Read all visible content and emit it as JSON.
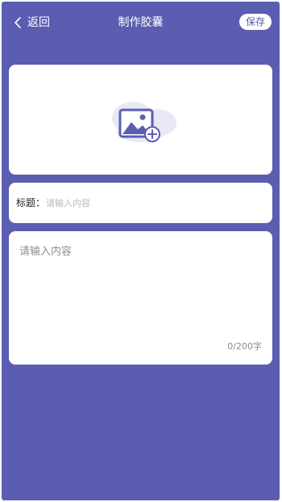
{
  "colors": {
    "background": "#5b5db1",
    "card": "#ffffff",
    "accent": "#5b5db1"
  },
  "header": {
    "back_icon": "chevron-left-icon",
    "back_label": "返回",
    "title": "制作胶囊",
    "save_label": "保存"
  },
  "image_upload": {
    "icon": "image-add-icon"
  },
  "title_field": {
    "label": "标题：",
    "placeholder": "请输入内容",
    "value": ""
  },
  "content_field": {
    "placeholder": "请输入内容",
    "value": "",
    "counter": "0/200字"
  }
}
